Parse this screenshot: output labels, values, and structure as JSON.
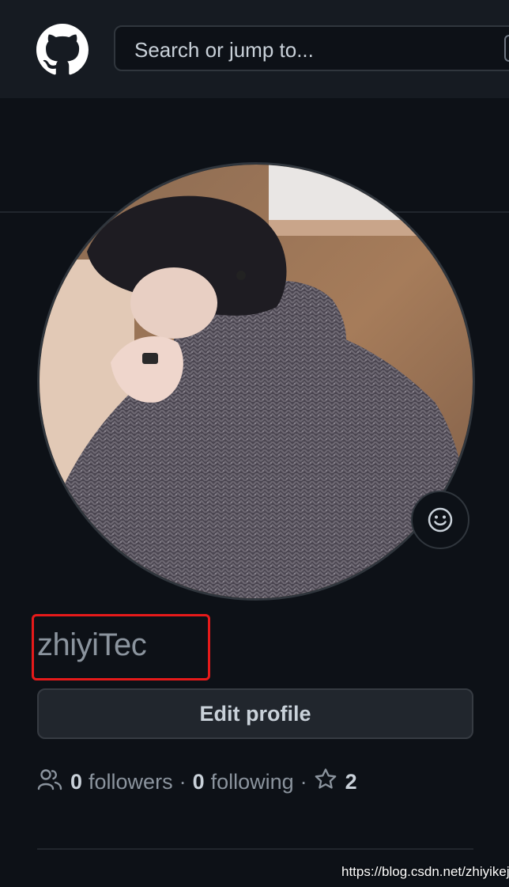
{
  "header": {
    "logo_icon": "github-octocat-icon",
    "search_placeholder": "Search or jump to..."
  },
  "profile": {
    "avatar_icon": "avatar-photo",
    "status_icon": "smiley-icon",
    "username": "zhiyiTec",
    "edit_button_label": "Edit profile",
    "followers_count": "0",
    "followers_label": "followers",
    "separator": "·",
    "following_count": "0",
    "following_label": "following",
    "stars_count": "2"
  },
  "watermark": "https://blog.csdn.net/zhiyikeji",
  "colors": {
    "background": "#0d1117",
    "header": "#161b22",
    "highlight_box": "#e61a1a",
    "muted_text": "#8b949e"
  }
}
